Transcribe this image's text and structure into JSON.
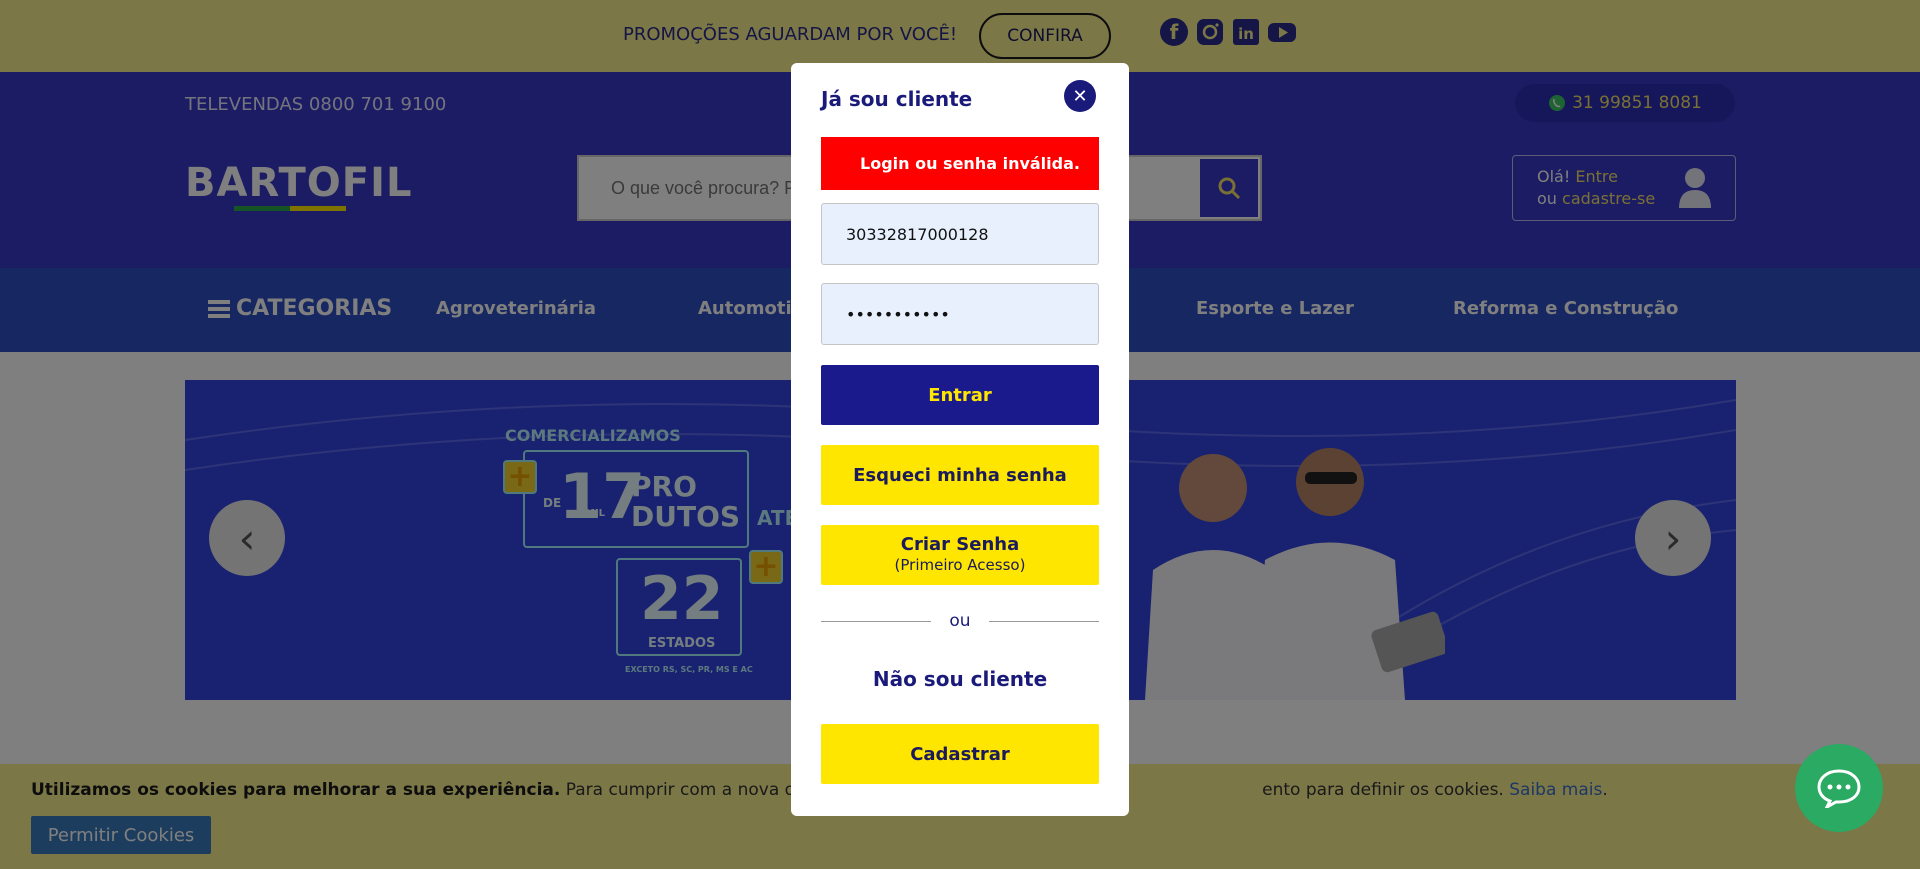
{
  "promo": {
    "text": "PROMOÇÕES AGUARDAM POR VOCÊ!",
    "button_label": "CONFIRA",
    "social": [
      "facebook-icon",
      "instagram-icon",
      "linkedin-icon",
      "youtube-icon"
    ]
  },
  "header": {
    "televendas": "TELEVENDAS 0800 701 9100",
    "whatsapp": "31 99851 8081",
    "logo": "BARTOFIL",
    "search_placeholder": "O que você procura? Produto, marca, código, etc.",
    "account_greeting": "Olá!",
    "account_login": "Entre",
    "account_or": "ou",
    "account_register": "cadastre-se"
  },
  "nav": {
    "categories_label": "CATEGORIAS",
    "items": [
      "Agroveterinária",
      "Automotivo",
      "Esporte e Lazer",
      "Reforma e Construção"
    ]
  },
  "banner": {
    "headline": "COMERCIALIZAMOS",
    "count_prefix": "DE",
    "count_value": "17",
    "count_unit": "MIL",
    "count_label_1": "PRO",
    "count_label_2": "DUTOS",
    "states_value": "22",
    "states_label": "ESTADOS",
    "states_note": "EXCETO RS, SC, PR, MS E AC",
    "partial_text": "ATE"
  },
  "cookie": {
    "bold_text": "Utilizamos os cookies para melhorar a sua experiência.",
    "text": "Para cumprir com a nova diretiva de priva",
    "text_end": "ento para definir os cookies.",
    "link": "Saiba mais",
    "button_label": "Permitir Cookies"
  },
  "modal": {
    "title": "Já sou cliente",
    "error": "Login ou senha inválida.",
    "login_value": "30332817000128",
    "password_value": "•••••••••••",
    "enter_label": "Entrar",
    "forgot_label": "Esqueci minha senha",
    "create_label": "Criar Senha",
    "create_sub": "(Primeiro Acesso)",
    "or_label": "ou",
    "not_client_label": "Não sou cliente",
    "register_label": "Cadastrar"
  },
  "colors": {
    "header_blue": "#3939c8",
    "nav_blue": "#2f4fc4",
    "promo_yellow": "#f6ef8f",
    "accent_yellow": "#ffe600",
    "error_red": "#ff0000",
    "modal_blue": "#1a1a8c"
  }
}
